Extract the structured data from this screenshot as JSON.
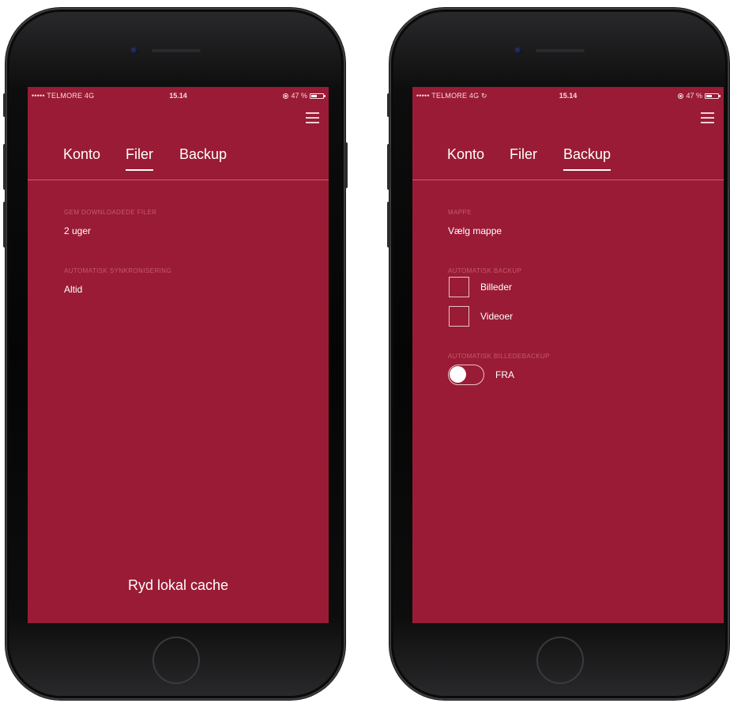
{
  "status_bar": {
    "carrier": "••••• TELMORE  4G",
    "carrier_right": "••••• TELMORE  4G ↻",
    "time": "15.14",
    "battery": "47 %",
    "battery_level": 0.47
  },
  "tabs": [
    "Konto",
    "Filer",
    "Backup"
  ],
  "files_screen": {
    "active_tab": "Filer",
    "download_label": "GEM DOWNLOADEDE FILER",
    "download_value": "2 uger",
    "sync_label": "AUTOMATISK SYNKRONISERING",
    "sync_value": "Altid",
    "clear_cache": "Ryd lokal cache"
  },
  "backup_screen": {
    "active_tab": "Backup",
    "folder_label": "MAPPE",
    "folder_value": "Vælg mappe",
    "auto_backup_label": "AUTOMATISK BACKUP",
    "auto_backup_options": [
      "Billeder",
      "Videoer"
    ],
    "photo_backup_label": "AUTOMATISK BILLEDEBACKUP",
    "photo_backup_state": "FRA"
  },
  "colors": {
    "screen_bg": "#9a1b35",
    "label": "#c55a70",
    "text": "#ffffff"
  }
}
